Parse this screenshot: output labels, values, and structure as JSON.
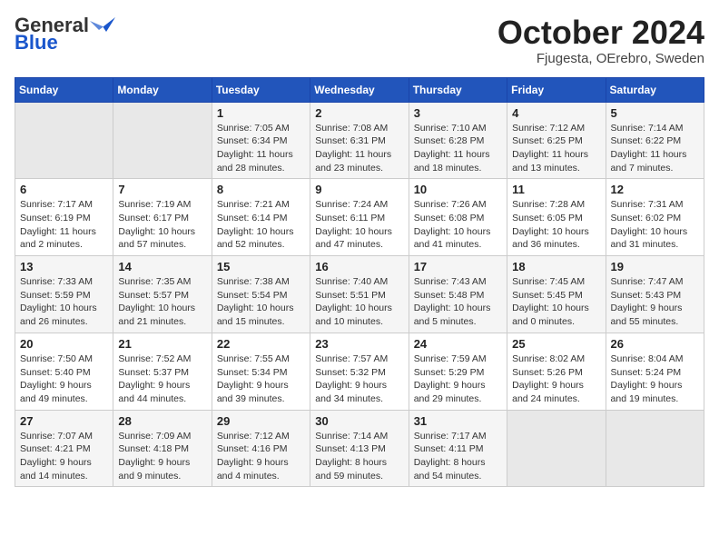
{
  "header": {
    "logo_general": "General",
    "logo_blue": "Blue",
    "month_title": "October 2024",
    "location": "Fjugesta, OErebro, Sweden"
  },
  "weekdays": [
    "Sunday",
    "Monday",
    "Tuesday",
    "Wednesday",
    "Thursday",
    "Friday",
    "Saturday"
  ],
  "weeks": [
    [
      {
        "day": "",
        "sunrise": "",
        "sunset": "",
        "daylight": ""
      },
      {
        "day": "",
        "sunrise": "",
        "sunset": "",
        "daylight": ""
      },
      {
        "day": "1",
        "sunrise": "Sunrise: 7:05 AM",
        "sunset": "Sunset: 6:34 PM",
        "daylight": "Daylight: 11 hours and 28 minutes."
      },
      {
        "day": "2",
        "sunrise": "Sunrise: 7:08 AM",
        "sunset": "Sunset: 6:31 PM",
        "daylight": "Daylight: 11 hours and 23 minutes."
      },
      {
        "day": "3",
        "sunrise": "Sunrise: 7:10 AM",
        "sunset": "Sunset: 6:28 PM",
        "daylight": "Daylight: 11 hours and 18 minutes."
      },
      {
        "day": "4",
        "sunrise": "Sunrise: 7:12 AM",
        "sunset": "Sunset: 6:25 PM",
        "daylight": "Daylight: 11 hours and 13 minutes."
      },
      {
        "day": "5",
        "sunrise": "Sunrise: 7:14 AM",
        "sunset": "Sunset: 6:22 PM",
        "daylight": "Daylight: 11 hours and 7 minutes."
      }
    ],
    [
      {
        "day": "6",
        "sunrise": "Sunrise: 7:17 AM",
        "sunset": "Sunset: 6:19 PM",
        "daylight": "Daylight: 11 hours and 2 minutes."
      },
      {
        "day": "7",
        "sunrise": "Sunrise: 7:19 AM",
        "sunset": "Sunset: 6:17 PM",
        "daylight": "Daylight: 10 hours and 57 minutes."
      },
      {
        "day": "8",
        "sunrise": "Sunrise: 7:21 AM",
        "sunset": "Sunset: 6:14 PM",
        "daylight": "Daylight: 10 hours and 52 minutes."
      },
      {
        "day": "9",
        "sunrise": "Sunrise: 7:24 AM",
        "sunset": "Sunset: 6:11 PM",
        "daylight": "Daylight: 10 hours and 47 minutes."
      },
      {
        "day": "10",
        "sunrise": "Sunrise: 7:26 AM",
        "sunset": "Sunset: 6:08 PM",
        "daylight": "Daylight: 10 hours and 41 minutes."
      },
      {
        "day": "11",
        "sunrise": "Sunrise: 7:28 AM",
        "sunset": "Sunset: 6:05 PM",
        "daylight": "Daylight: 10 hours and 36 minutes."
      },
      {
        "day": "12",
        "sunrise": "Sunrise: 7:31 AM",
        "sunset": "Sunset: 6:02 PM",
        "daylight": "Daylight: 10 hours and 31 minutes."
      }
    ],
    [
      {
        "day": "13",
        "sunrise": "Sunrise: 7:33 AM",
        "sunset": "Sunset: 5:59 PM",
        "daylight": "Daylight: 10 hours and 26 minutes."
      },
      {
        "day": "14",
        "sunrise": "Sunrise: 7:35 AM",
        "sunset": "Sunset: 5:57 PM",
        "daylight": "Daylight: 10 hours and 21 minutes."
      },
      {
        "day": "15",
        "sunrise": "Sunrise: 7:38 AM",
        "sunset": "Sunset: 5:54 PM",
        "daylight": "Daylight: 10 hours and 15 minutes."
      },
      {
        "day": "16",
        "sunrise": "Sunrise: 7:40 AM",
        "sunset": "Sunset: 5:51 PM",
        "daylight": "Daylight: 10 hours and 10 minutes."
      },
      {
        "day": "17",
        "sunrise": "Sunrise: 7:43 AM",
        "sunset": "Sunset: 5:48 PM",
        "daylight": "Daylight: 10 hours and 5 minutes."
      },
      {
        "day": "18",
        "sunrise": "Sunrise: 7:45 AM",
        "sunset": "Sunset: 5:45 PM",
        "daylight": "Daylight: 10 hours and 0 minutes."
      },
      {
        "day": "19",
        "sunrise": "Sunrise: 7:47 AM",
        "sunset": "Sunset: 5:43 PM",
        "daylight": "Daylight: 9 hours and 55 minutes."
      }
    ],
    [
      {
        "day": "20",
        "sunrise": "Sunrise: 7:50 AM",
        "sunset": "Sunset: 5:40 PM",
        "daylight": "Daylight: 9 hours and 49 minutes."
      },
      {
        "day": "21",
        "sunrise": "Sunrise: 7:52 AM",
        "sunset": "Sunset: 5:37 PM",
        "daylight": "Daylight: 9 hours and 44 minutes."
      },
      {
        "day": "22",
        "sunrise": "Sunrise: 7:55 AM",
        "sunset": "Sunset: 5:34 PM",
        "daylight": "Daylight: 9 hours and 39 minutes."
      },
      {
        "day": "23",
        "sunrise": "Sunrise: 7:57 AM",
        "sunset": "Sunset: 5:32 PM",
        "daylight": "Daylight: 9 hours and 34 minutes."
      },
      {
        "day": "24",
        "sunrise": "Sunrise: 7:59 AM",
        "sunset": "Sunset: 5:29 PM",
        "daylight": "Daylight: 9 hours and 29 minutes."
      },
      {
        "day": "25",
        "sunrise": "Sunrise: 8:02 AM",
        "sunset": "Sunset: 5:26 PM",
        "daylight": "Daylight: 9 hours and 24 minutes."
      },
      {
        "day": "26",
        "sunrise": "Sunrise: 8:04 AM",
        "sunset": "Sunset: 5:24 PM",
        "daylight": "Daylight: 9 hours and 19 minutes."
      }
    ],
    [
      {
        "day": "27",
        "sunrise": "Sunrise: 7:07 AM",
        "sunset": "Sunset: 4:21 PM",
        "daylight": "Daylight: 9 hours and 14 minutes."
      },
      {
        "day": "28",
        "sunrise": "Sunrise: 7:09 AM",
        "sunset": "Sunset: 4:18 PM",
        "daylight": "Daylight: 9 hours and 9 minutes."
      },
      {
        "day": "29",
        "sunrise": "Sunrise: 7:12 AM",
        "sunset": "Sunset: 4:16 PM",
        "daylight": "Daylight: 9 hours and 4 minutes."
      },
      {
        "day": "30",
        "sunrise": "Sunrise: 7:14 AM",
        "sunset": "Sunset: 4:13 PM",
        "daylight": "Daylight: 8 hours and 59 minutes."
      },
      {
        "day": "31",
        "sunrise": "Sunrise: 7:17 AM",
        "sunset": "Sunset: 4:11 PM",
        "daylight": "Daylight: 8 hours and 54 minutes."
      },
      {
        "day": "",
        "sunrise": "",
        "sunset": "",
        "daylight": ""
      },
      {
        "day": "",
        "sunrise": "",
        "sunset": "",
        "daylight": ""
      }
    ]
  ]
}
